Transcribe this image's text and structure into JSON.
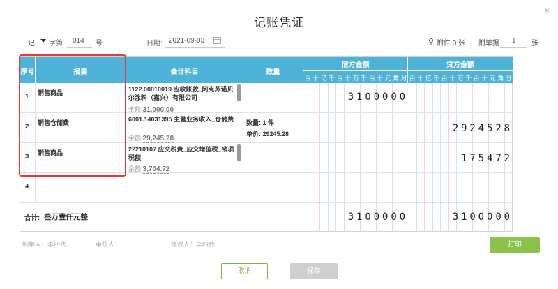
{
  "dialog": {
    "title": "记账凭证",
    "close_glyph": "×"
  },
  "info": {
    "voucher_word": "记",
    "zi_label": "字第",
    "number": "014",
    "hao_label": "号",
    "date_label": "日期:",
    "date_value": "2021-09-03",
    "attach_text": "附件 0 张",
    "attach_icon": "paperclip-icon",
    "docs_label": "附单据",
    "docs_value": "1",
    "docs_unit": "张"
  },
  "table": {
    "headers": {
      "seq": "序号",
      "summary": "摘要",
      "account": "会计科目",
      "quantity": "数量",
      "debit": "借方金额",
      "credit": "贷方金额"
    },
    "digit_labels": [
      "百",
      "十",
      "亿",
      "千",
      "百",
      "十",
      "万",
      "千",
      "百",
      "十",
      "元",
      "角",
      "分"
    ],
    "rows": [
      {
        "seq": "1",
        "summary": "销售商品",
        "account": "1122.00010019 应收账款_阿克苏诺贝尔涂料（嘉兴）有限公司",
        "balance_label": "余额:",
        "balance": "31,000.00",
        "quantity": "",
        "price": "",
        "debit": "3100000",
        "credit": ""
      },
      {
        "seq": "2",
        "summary": "销售仓储费",
        "account": "6001.14031395 主营业务收入_仓储费",
        "balance_label": "余额:",
        "balance": "29,245.28",
        "quantity": "数量: 1 件",
        "price": "单价: 29245.28",
        "debit": "",
        "credit": "2924528"
      },
      {
        "seq": "3",
        "summary": "销售商品",
        "account": "22210107 应交税费_应交增值税_销项税额",
        "balance_label": "余额:",
        "balance": "3,704.72",
        "quantity": "",
        "price": "",
        "debit": "",
        "credit": "175472"
      },
      {
        "seq": "4",
        "summary": "",
        "account": "",
        "balance_label": "",
        "balance": "",
        "quantity": "",
        "price": "",
        "debit": "",
        "credit": ""
      }
    ],
    "total": {
      "label": "合计:",
      "words": "叁万壹仟元整",
      "debit": "3100000",
      "credit": "3100000"
    }
  },
  "footer": {
    "maker": "制单人：李四代",
    "auditor": "审核人：",
    "modifier": "修改人：李四代"
  },
  "buttons": {
    "print": "打印",
    "cancel": "取消",
    "save": "保存"
  },
  "colors": {
    "header": "#4fb3d9",
    "highlight": "#e53935",
    "print": "#8bc34a"
  }
}
